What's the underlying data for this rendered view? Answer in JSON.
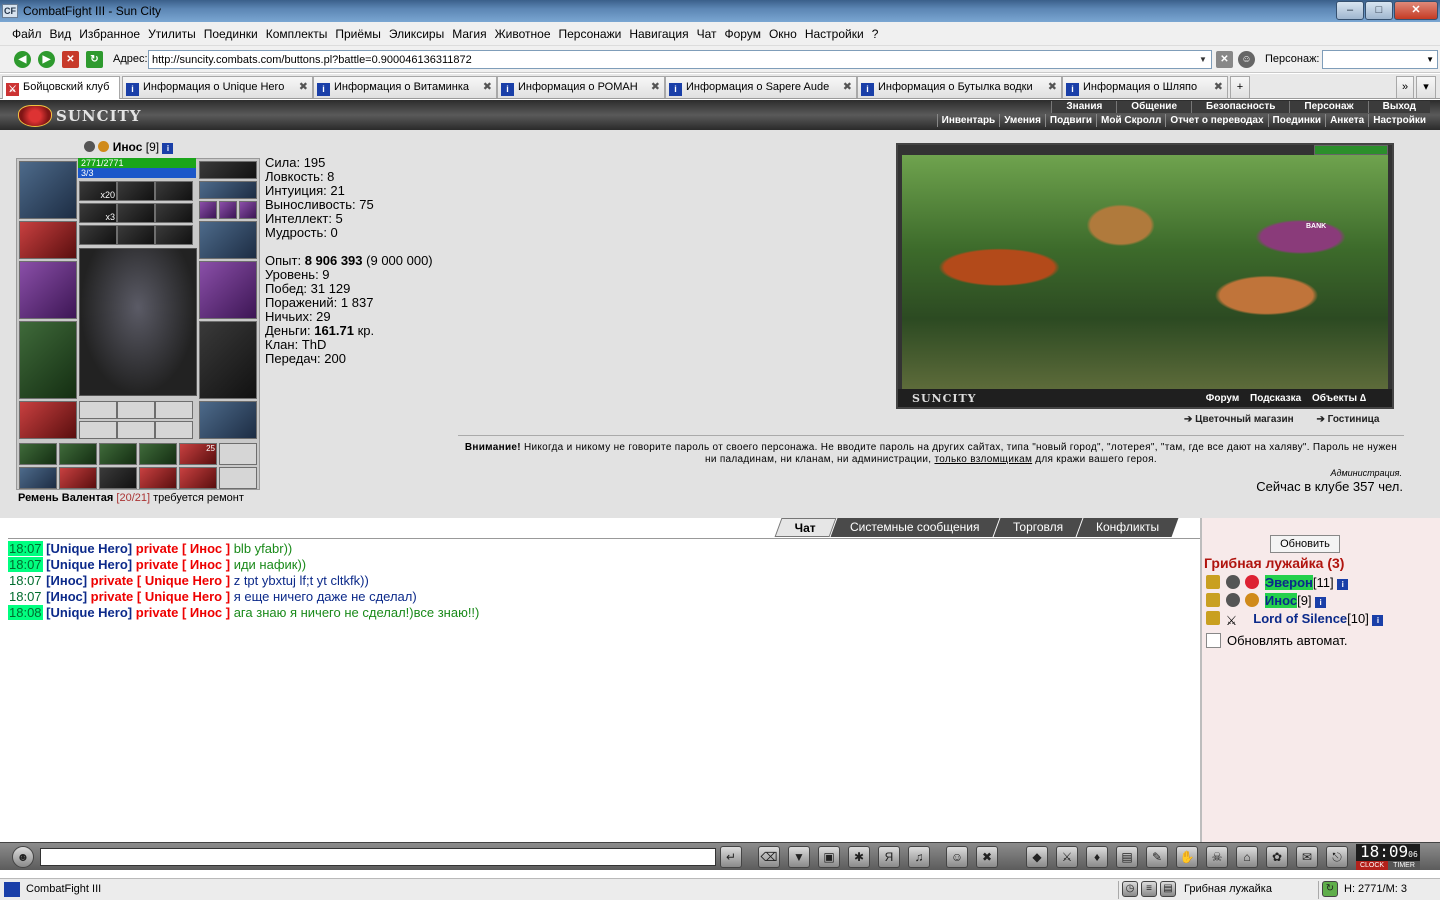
{
  "window": {
    "app_icon": "CF",
    "title": "CombatFight III - Sun City",
    "minimize": "–",
    "maximize": "□",
    "close": "✕"
  },
  "menu": [
    "Файл",
    "Вид",
    "Избранное",
    "Утилиты",
    "Поединки",
    "Комплекты",
    "Приёмы",
    "Эликсиры",
    "Магия",
    "Животное",
    "Персонажи",
    "Навигация",
    "Чат",
    "Форум",
    "Окно",
    "Настройки",
    "?"
  ],
  "address": {
    "label": "Адрес:",
    "url": "http://suncity.combats.com/buttons.pl?battle=0.900046136311872",
    "persona_label": "Персонаж:"
  },
  "tabs": [
    {
      "label": "Бойцовский клуб",
      "active": true
    },
    {
      "label": "Информация о Unique Hero"
    },
    {
      "label": "Информация о Витаминка"
    },
    {
      "label": "Информация о РОМАН"
    },
    {
      "label": "Информация о Sapere Aude"
    },
    {
      "label": "Информация о Бутылка водки"
    },
    {
      "label": "Информация о Шляпо"
    }
  ],
  "game": {
    "logo": "SUNCITY",
    "topnav": [
      "Знания",
      "Общение",
      "Безопасность",
      "Персонаж",
      "Выход"
    ],
    "subnav": [
      "Инвентарь",
      "Умения",
      "Подвиги",
      "Мой Скролл",
      "Отчет о переводах",
      "Поединки",
      "Анкета",
      "Настройки"
    ]
  },
  "character": {
    "name": "Инос",
    "level": "[9]",
    "hp": "2771/2771",
    "mp": "3/3",
    "slot_counts": {
      "a": "x20",
      "b": "x3",
      "c": "25"
    },
    "item_note": {
      "name": "Ремень Валентая",
      "durability": "[20/21]",
      "status": "требуется ремонт"
    }
  },
  "stats": {
    "strength": "Сила: 195",
    "agility": "Ловкость: 8",
    "intuition": "Интуиция: 21",
    "endurance": "Выносливость: 75",
    "intellect": "Интеллект: 5",
    "wisdom": "Мудрость: 0",
    "exp_label": "Опыт: ",
    "exp_value": "8 906 393",
    "exp_next": " (9 000 000)",
    "level": "Уровень: 9",
    "wins": "Побед: 31 129",
    "losses": "Поражений: 1 837",
    "draws": "Ничьих: 29",
    "money_label": "Деньги: ",
    "money_value": "161.71",
    "money_unit": " кр.",
    "clan": "Клан: ThD",
    "transfers": "Передач: 200"
  },
  "scene": {
    "title": "SUNCITY",
    "links": [
      "Форум",
      "Подсказка",
      "Объекты ∆"
    ],
    "shop_links": [
      "Цветочный магазин",
      "Гостиница"
    ],
    "building_label": "BANK"
  },
  "warning": {
    "bold": "Внимание!",
    "text1": " Никогда и никому не говорите пароль от своего персонажа. Не вводите пароль на других сайтах, типа \"новый город\", \"лотерея\", \"там, где все дают на халяву\". Пароль не нужен ни паладинам, ни кланам, ни администрации, ",
    "link": "только взломщикам",
    "text2": " для кражи вашего героя.",
    "admin": "Администрация.",
    "online": "Сейчас в клубе 357 чел."
  },
  "chat_tabs": [
    "Чат",
    "Системные сообщения",
    "Торговля",
    "Конфликты"
  ],
  "chat": [
    {
      "time": "18:07",
      "nick": "[Unique Hero]",
      "private": "private [ Инос ]",
      "msg": "blb yfabr))",
      "green": true
    },
    {
      "time": "18:07",
      "nick": "[Unique Hero]",
      "private": "private [ Инос ]",
      "msg": "иди нафик))",
      "green": true
    },
    {
      "time": "18:07",
      "nick": "[Инос]",
      "private": "private [ Unique Hero ]",
      "msg": "z tpt ybxtuj lf;t yt cltkfk))",
      "green": false
    },
    {
      "time": "18:07",
      "nick": "[Инос]",
      "private": "private [ Unique Hero ]",
      "msg": "я еще ничего даже не сделал)",
      "green": false
    },
    {
      "time": "18:08",
      "nick": "[Unique Hero]",
      "private": "private [ Инос ]",
      "msg": "ага знаю я ничего не сделал!)все знаю!!)",
      "green": true
    }
  ],
  "side": {
    "refresh": "Обновить",
    "room": "Грибная лужайка (3)",
    "players": [
      {
        "name": "Эверон",
        "level": "[11]"
      },
      {
        "name": "Инос",
        "level": "[9]"
      },
      {
        "name": "Lord of Silence",
        "level": "[10]"
      }
    ],
    "auto": "Обновлять автомат."
  },
  "clock": {
    "time": "18:09",
    "seconds": "06",
    "clock_label": "CLOCK",
    "timer_label": "TIMER"
  },
  "status": {
    "title": "CombatFight III",
    "location": "Грибная лужайка",
    "hp": "H: 2771/M: 3"
  },
  "colors": {
    "hp": "#1aa51a",
    "mp": "#1c57c9",
    "chat_time_bg": "#00ff80",
    "private": "#ee0000",
    "room_title": "#b0140e"
  }
}
